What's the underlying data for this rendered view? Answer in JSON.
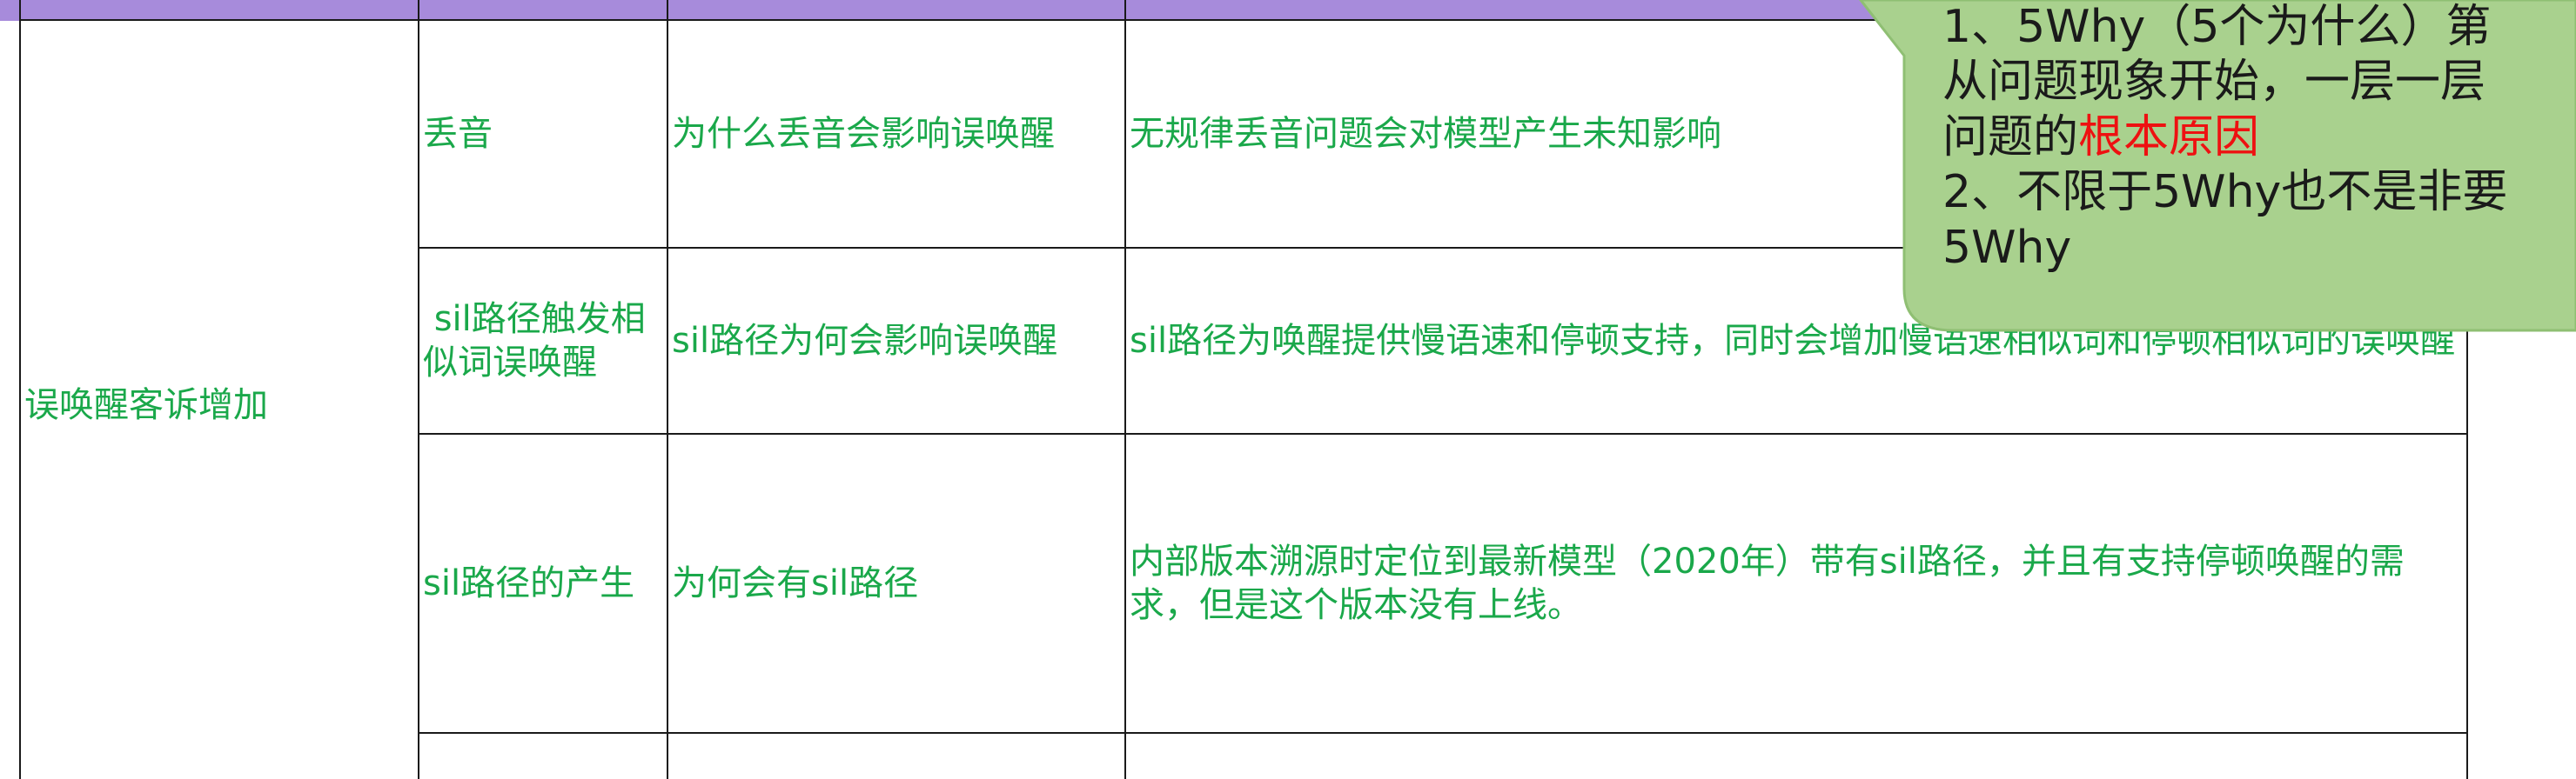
{
  "table": {
    "category": "误唤醒客诉增加",
    "rows": [
      {
        "phenomenon": "丢音",
        "question": "为什么丢音会影响误唤醒",
        "answer": "无规律丢音问题会对模型产生未知影响"
      },
      {
        "phenomenon": " sil路径触发相似词误唤醒",
        "question": "sil路径为何会影响误唤醒",
        "answer": "sil路径为唤醒提供慢语速和停顿支持，同时会增加慢语速相似词和停顿相似词的误唤醒"
      },
      {
        "phenomenon": "sil路径的产生",
        "question": "为何会有sil路径",
        "answer": "内部版本溯源时定位到最新模型（2020年）带有sil路径，并且有支持停顿唤醒的需求，但是这个版本没有上线。"
      }
    ]
  },
  "callout": {
    "line1": "1、5Why（5个为什么）第",
    "line2": "从问题现象开始，一层一层",
    "line3_prefix": "问题的",
    "line3_highlight": "根本原因",
    "line4": "2、不限于5Why也不是非要",
    "line5": "5Why"
  },
  "colors": {
    "header_band": "#a78bdb",
    "cell_text": "#1aa84a",
    "callout_fill": "#a9d18e",
    "callout_border": "#8fbf73",
    "highlight": "#ee1111",
    "grid": "#1a1a1a"
  }
}
